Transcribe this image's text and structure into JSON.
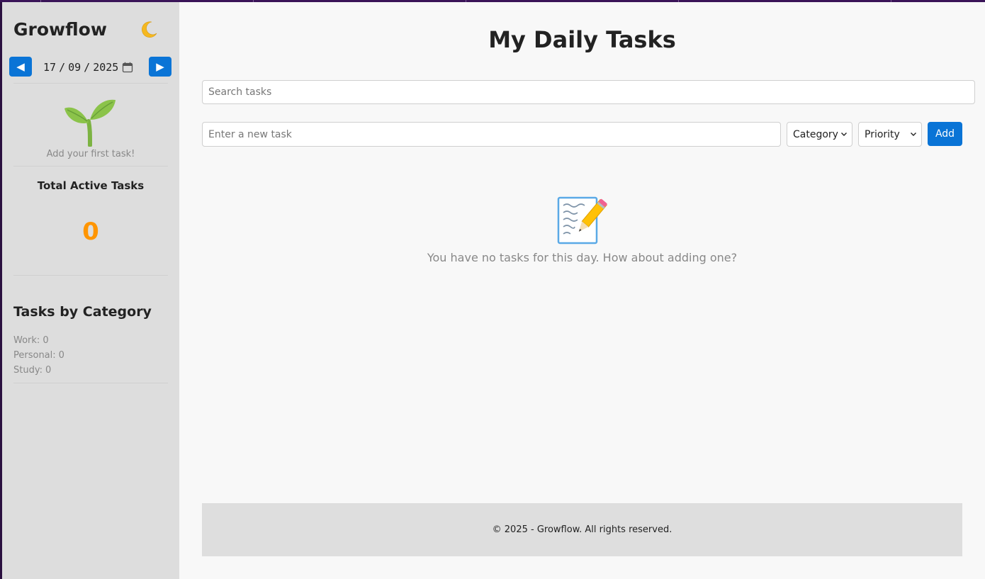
{
  "sidebar": {
    "brand": "Growflow",
    "theme_toggle_icon": "moon-icon",
    "prev_label": "◀",
    "next_label": "▶",
    "date": {
      "day": "17",
      "month": "09",
      "year": "2025",
      "separator": "/"
    },
    "empty_hint": "Add your first task!",
    "active_title": "Total Active Tasks",
    "active_count": "0",
    "category_title": "Tasks by Category",
    "categories": [
      {
        "label": "Work:",
        "count": "0"
      },
      {
        "label": "Personal:",
        "count": "0"
      },
      {
        "label": "Study:",
        "count": "0"
      }
    ],
    "accent_color": "#ff9500"
  },
  "main": {
    "title": "My Daily Tasks",
    "search_placeholder": "Search tasks",
    "new_task_placeholder": "Enter a new task",
    "category_select": "Category",
    "priority_select": "Priority",
    "add_label": "Add",
    "empty_message": "You have no tasks for this day. How about adding one?",
    "empty_icon": "memo-icon"
  },
  "footer": {
    "text": "© 2025 - Growflow. All rights reserved."
  },
  "colors": {
    "primary": "#0a74d6",
    "sidebar_bg": "#dddddd",
    "main_bg": "#f8f8f8"
  }
}
